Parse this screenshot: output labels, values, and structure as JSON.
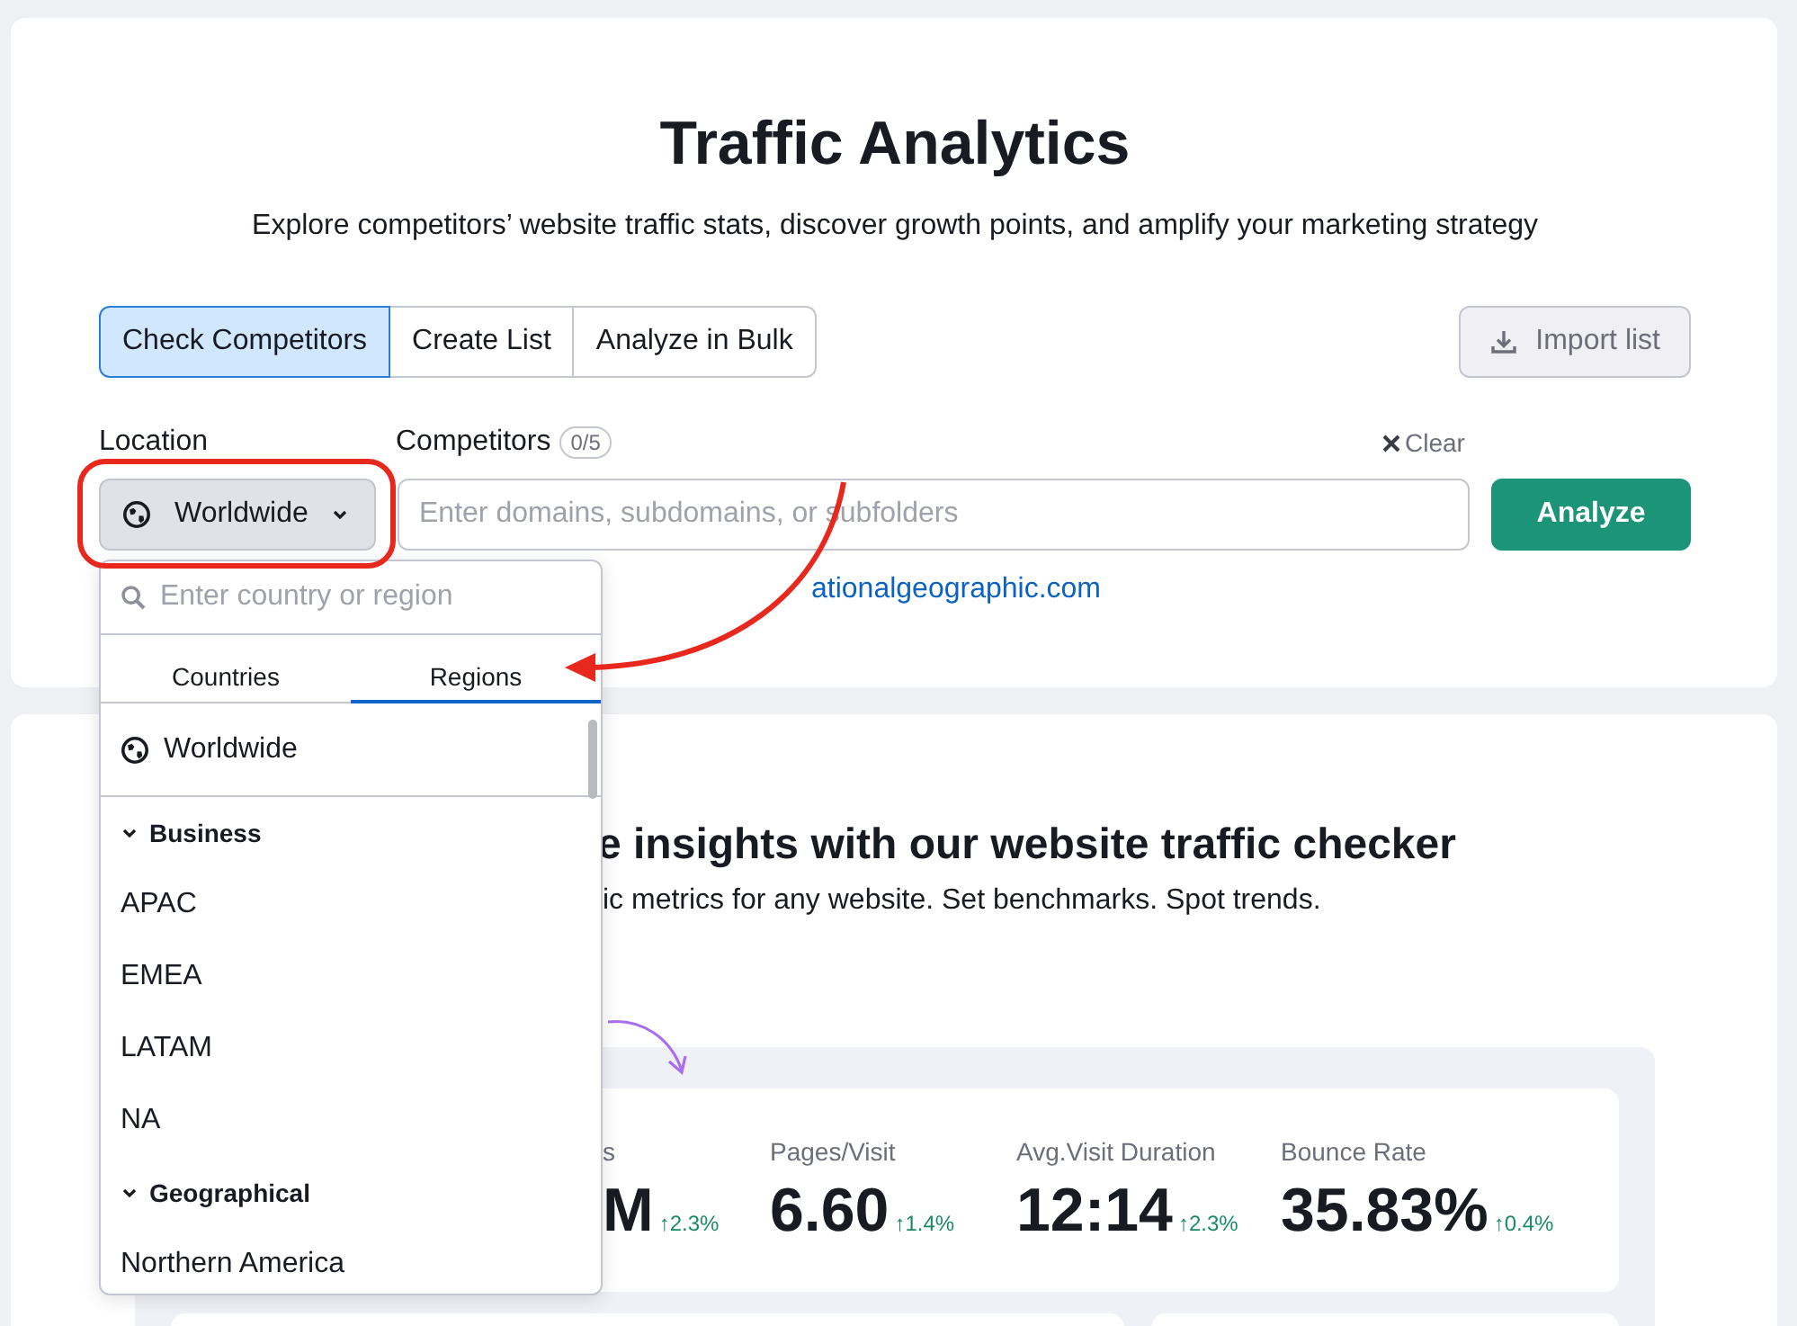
{
  "title": "Traffic Analytics",
  "subtitle": "Explore competitors’ website traffic stats, discover growth points, and amplify your marketing strategy",
  "mode_tabs": [
    {
      "label": "Check Competitors",
      "selected": true
    },
    {
      "label": "Create List",
      "selected": false
    },
    {
      "label": "Analyze in Bulk",
      "selected": false
    }
  ],
  "import_button": "Import list",
  "location": {
    "label": "Location",
    "value": "Worldwide"
  },
  "competitors": {
    "label": "Competitors",
    "count": "0/5",
    "clear": "Clear",
    "placeholder": "Enter domains, subdomains, or subfolders"
  },
  "analyze_button": "Analyze",
  "example_link": "ationalgeographic.com",
  "location_dropdown": {
    "search_placeholder": "Enter country or region",
    "tabs": [
      {
        "label": "Countries",
        "selected": false
      },
      {
        "label": "Regions",
        "selected": true
      }
    ],
    "items": [
      {
        "kind": "option",
        "label": "Worldwide"
      },
      {
        "kind": "group",
        "label": "Business",
        "expanded": true,
        "children": [
          {
            "label": "APAC"
          },
          {
            "label": "EMEA"
          },
          {
            "label": "LATAM"
          },
          {
            "label": "NA"
          }
        ]
      },
      {
        "kind": "group",
        "label": "Geographical",
        "expanded": true,
        "children": [
          {
            "label": "Northern America"
          }
        ]
      }
    ]
  },
  "insights": {
    "heading": "e insights with our website traffic checker",
    "subheading": "ic metrics for any website. Set benchmarks. Spot trends.",
    "metrics": [
      {
        "label": "s",
        "value": "M",
        "change": "↑2.3%"
      },
      {
        "label": "Pages/Visit",
        "value": "6.60",
        "change": "↑1.4%"
      },
      {
        "label": "Avg.Visit Duration",
        "value": "12:14",
        "change": "↑2.3%"
      },
      {
        "label": "Bounce Rate",
        "value": "35.83%",
        "change": "↑0.4%"
      }
    ]
  }
}
